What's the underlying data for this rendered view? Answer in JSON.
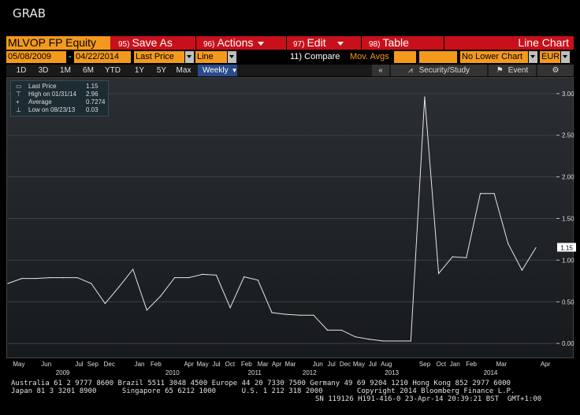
{
  "screen_title": "GRAB",
  "toolbar": {
    "ticker": "MLVOP FP Equity",
    "save_as": {
      "num": "95)",
      "label": "Save As"
    },
    "actions": {
      "num": "96)",
      "label": "Actions"
    },
    "edit": {
      "num": "97)",
      "label": "Edit"
    },
    "table": {
      "num": "98)",
      "label": "Table"
    },
    "chart_kind": "Line Chart"
  },
  "settings": {
    "start_date": "05/08/2009",
    "end_date": "04/22/2014",
    "field": "Last Price",
    "style": "Line",
    "compare": "11) Compare",
    "mov_avgs": "Mov. Avgs",
    "lower_chart": "No Lower Chart",
    "currency": "EUR"
  },
  "ranges": [
    "1D",
    "3D",
    "1M",
    "6M",
    "YTD",
    "1Y",
    "5Y",
    "Max"
  ],
  "frequency": "Weekly",
  "tools": {
    "security_study": "Security/Study",
    "event": "Event"
  },
  "legend": {
    "last_price": {
      "label": "Last Price",
      "value": "1.15"
    },
    "high": {
      "label": "High on 01/31/14",
      "value": "2.96"
    },
    "average": {
      "label": "Average",
      "value": "0.7274"
    },
    "low": {
      "label": "Low on 08/23/13",
      "value": "0.03"
    }
  },
  "chart_data": {
    "type": "line",
    "series": [
      {
        "values": [
          0.72,
          0.78,
          0.78,
          0.79,
          0.79,
          0.79,
          0.72,
          0.48,
          0.68,
          0.89,
          0.4,
          0.57,
          0.79,
          0.79,
          0.83,
          0.82,
          0.43,
          0.8,
          0.76,
          0.37,
          0.35,
          0.34,
          0.34,
          0.16,
          0.16,
          0.08,
          0.05,
          0.03,
          0.03,
          0.03,
          2.96,
          0.84,
          1.04,
          1.03,
          1.8,
          1.8,
          1.2,
          0.88,
          1.15
        ]
      }
    ],
    "ylim": [
      -0.15,
      3.15
    ],
    "y_ticks": [
      "0.00",
      "0.50",
      "1.00",
      "1.50",
      "2.00",
      "2.50",
      "3.00"
    ],
    "last_value_tag": "1.15",
    "x_month_labels": [
      {
        "t": 0.02,
        "label": "May"
      },
      {
        "t": 0.07,
        "label": "Jun"
      },
      {
        "t": 0.13,
        "label": "Jul"
      },
      {
        "t": 0.155,
        "label": "Sep"
      },
      {
        "t": 0.185,
        "label": "Dec"
      },
      {
        "t": 0.24,
        "label": "Jan"
      },
      {
        "t": 0.27,
        "label": "Feb"
      },
      {
        "t": 0.33,
        "label": "Apr"
      },
      {
        "t": 0.355,
        "label": "May"
      },
      {
        "t": 0.38,
        "label": "Jul"
      },
      {
        "t": 0.405,
        "label": "Oct"
      },
      {
        "t": 0.435,
        "label": "Feb"
      },
      {
        "t": 0.465,
        "label": "Mar"
      },
      {
        "t": 0.49,
        "label": "Apr"
      },
      {
        "t": 0.515,
        "label": "Mar"
      },
      {
        "t": 0.565,
        "label": "Jun"
      },
      {
        "t": 0.59,
        "label": "Jul"
      },
      {
        "t": 0.615,
        "label": "Dec"
      },
      {
        "t": 0.64,
        "label": "May"
      },
      {
        "t": 0.665,
        "label": "Jul"
      },
      {
        "t": 0.69,
        "label": "Aug"
      },
      {
        "t": 0.76,
        "label": "Sep"
      },
      {
        "t": 0.79,
        "label": "Oct"
      },
      {
        "t": 0.815,
        "label": "Jan"
      },
      {
        "t": 0.845,
        "label": "Feb"
      },
      {
        "t": 0.9,
        "label": "Mar"
      },
      {
        "t": 0.98,
        "label": "Apr"
      }
    ],
    "x_year_labels": [
      {
        "t": 0.1,
        "label": "2009"
      },
      {
        "t": 0.3,
        "label": "2010"
      },
      {
        "t": 0.45,
        "label": "2011"
      },
      {
        "t": 0.55,
        "label": "2012"
      },
      {
        "t": 0.7,
        "label": "2013"
      },
      {
        "t": 0.88,
        "label": "2014"
      }
    ]
  },
  "footer": {
    "line1": "Australia 61 2 9777 8600 Brazil 5511 3048 4500 Europe 44 20 7330 7500 Germany 49 69 9204 1210 Hong Kong 852 2977 6000",
    "line2": "Japan 81 3 3201 8900      Singapore 65 6212 1000      U.S. 1 212 318 2000        Copyright 2014 Bloomberg Finance L.P.",
    "line3": "SN 119126 H191-416-0 23-Apr-14 20:39:21 BST  GMT+1:00"
  }
}
